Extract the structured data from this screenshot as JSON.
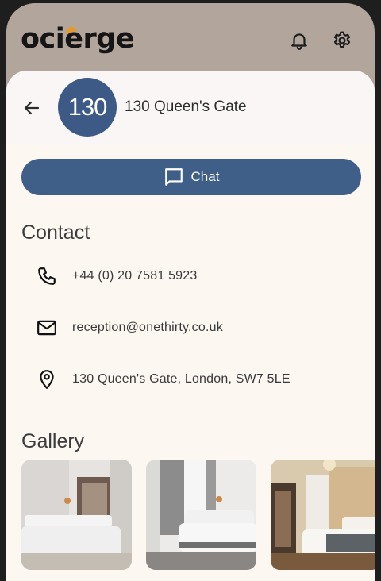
{
  "app": {
    "logo_text_left": "oci",
    "logo_text_dot": "e",
    "logo_text_right": "rge",
    "brand_accent": "#e39a2c"
  },
  "topbar": {
    "bell_icon": "bell-icon",
    "settings_icon": "gear-icon"
  },
  "header": {
    "back_icon": "arrow-left-icon",
    "avatar_text": "130",
    "title": "130 Queen's Gate"
  },
  "chat_button": {
    "label": "Chat",
    "icon": "chat-bubble-icon",
    "color": "#3f5f88"
  },
  "contact": {
    "section_title": "Contact",
    "phone": "+44 (0) 20 7581 5923",
    "email": "reception@onethirty.co.uk",
    "address": "130 Queen's Gate, London, SW7 5LE"
  },
  "gallery": {
    "section_title": "Gallery",
    "images": [
      "hotel-room-photo-1",
      "hotel-room-photo-2",
      "hotel-room-photo-3"
    ]
  }
}
